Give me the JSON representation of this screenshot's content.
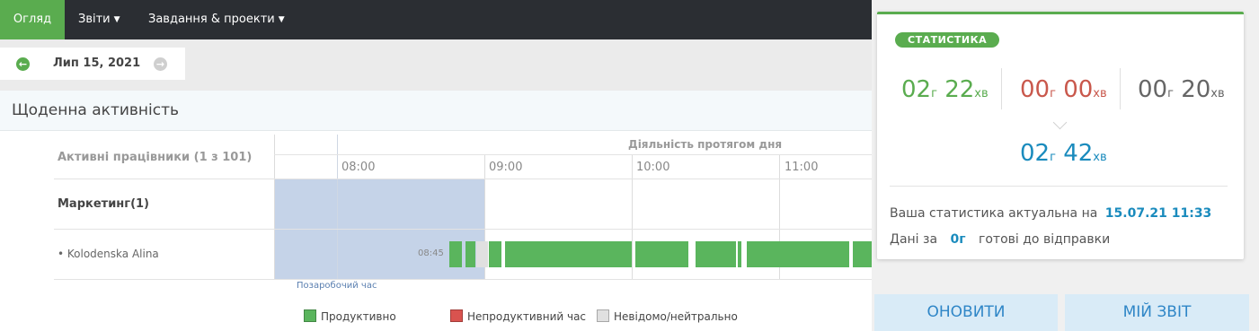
{
  "nav": {
    "overview": "Огляд",
    "reports": "Звіти",
    "tasks_projects": "Завдання & проекти"
  },
  "date_nav": {
    "date": "Лип 15, 2021",
    "prev_icon": "arrow-left-circle",
    "next_icon": "arrow-right-circle"
  },
  "section": {
    "title": "Щоденна активність"
  },
  "table": {
    "active_workers": "Активні працівники (1 з 101)",
    "activity_header": "Діяльність протягом дня",
    "hours": [
      "08:00",
      "09:00",
      "10:00",
      "11:00"
    ],
    "department": "Маркетинг(1)",
    "employee": "• Kolodenska Alina",
    "start_time": "08:45",
    "overtime_label": "Позаробочий час"
  },
  "legend": {
    "productive": "Продуктивно",
    "unproductive": "Непродуктивний час",
    "neutral": "Невідомо/нейтрально"
  },
  "stats": {
    "badge": "СТАТИСТИКА",
    "productive": {
      "h": "02",
      "hu": "г",
      "m": "22",
      "mu": "хв"
    },
    "unproductive": {
      "h": "00",
      "hu": "г",
      "m": "00",
      "mu": "хв"
    },
    "neutral": {
      "h": "00",
      "hu": "г",
      "m": "20",
      "mu": "хв"
    },
    "total": {
      "h": "02",
      "hu": "г",
      "m": "42",
      "mu": "хв"
    },
    "actual_label": "Ваша статистика актуальна на",
    "actual_value": "15.07.21 11:33",
    "data_label": "Дані за",
    "data_value": "0г",
    "data_suffix": "готові до відправки"
  },
  "buttons": {
    "refresh": "ОНОВИТИ",
    "my_report": "МІЙ ЗВІТ"
  },
  "colors": {
    "productive": "#5ab55d",
    "unproductive": "#d9534f",
    "neutral": "#e0e0e0",
    "total": "#1a8bbd",
    "overtime": "#c5d3e8"
  }
}
